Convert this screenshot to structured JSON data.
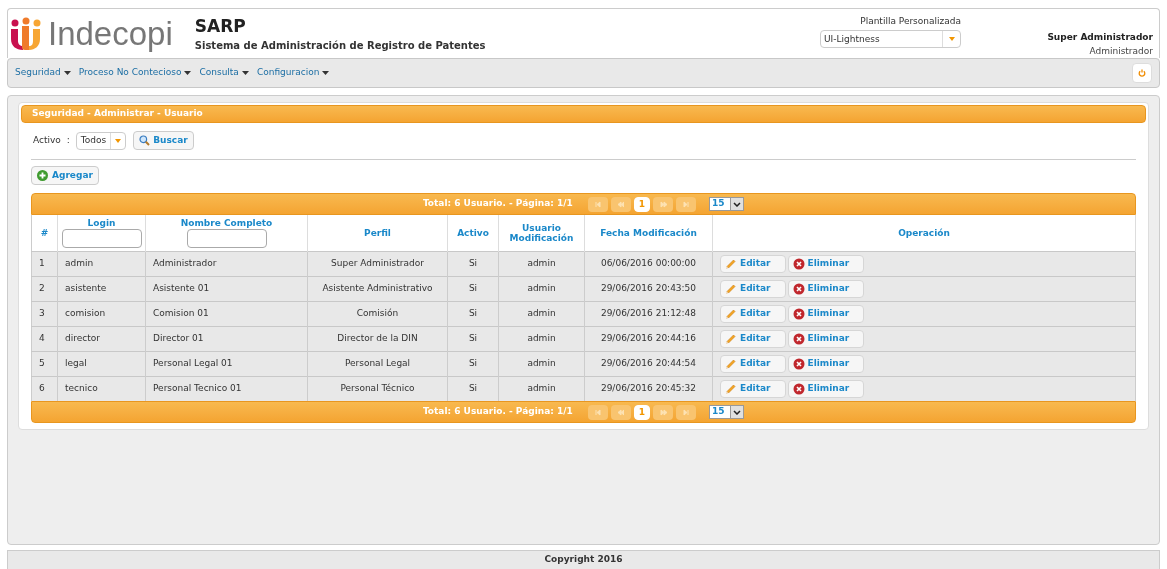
{
  "brand": {
    "logo_text": "Indecopi",
    "app_title": "SARP",
    "app_subtitle": "Sistema de Administración de Registro de Patentes"
  },
  "theme": {
    "label": "Plantilla Personalizada",
    "value": "UI-Lightness"
  },
  "user": {
    "name": "Super Administrador",
    "role": "Administrador"
  },
  "menu": [
    {
      "label": "Seguridad"
    },
    {
      "label": "Proceso No Contecioso"
    },
    {
      "label": "Consulta"
    },
    {
      "label": "Configuracion"
    }
  ],
  "panel": {
    "title": "Seguridad - Administrar - Usuario"
  },
  "filter": {
    "label": "Activo",
    "separator": ":",
    "value": "Todos",
    "search_button": "Buscar"
  },
  "add_button": "Agregar",
  "table": {
    "pagers": [
      {
        "summary": "Total: 6 Usuario. - Página: 1/1",
        "nav": [
          {
            "kind": "first",
            "disabled": true
          },
          {
            "kind": "prev",
            "disabled": true
          },
          {
            "kind": "page",
            "label": "1",
            "selected": true
          },
          {
            "kind": "next",
            "disabled": true
          },
          {
            "kind": "last",
            "disabled": true
          }
        ],
        "per_page": "15"
      },
      {
        "summary": "Total: 6 Usuario. - Página: 1/1",
        "nav": [
          {
            "kind": "first",
            "disabled": true
          },
          {
            "kind": "prev",
            "disabled": true
          },
          {
            "kind": "page",
            "label": "1",
            "selected": true
          },
          {
            "kind": "next",
            "disabled": true
          },
          {
            "kind": "last",
            "disabled": true
          }
        ],
        "per_page": "15"
      }
    ],
    "columns": [
      {
        "label": "#",
        "filter": false
      },
      {
        "label": "Login",
        "filter": true
      },
      {
        "label": "Nombre Completo",
        "filter": true
      },
      {
        "label": "Perfil",
        "filter": false
      },
      {
        "label": "Activo",
        "filter": false
      },
      {
        "label": "Usuario Modificación",
        "filter": false
      },
      {
        "label": "Fecha Modificación",
        "filter": false
      },
      {
        "label": "Operación",
        "filter": false
      }
    ],
    "rows": [
      {
        "cells": [
          "1",
          "admin",
          "Administrador",
          "Super Administrador",
          "Si",
          "admin",
          "06/06/2016 00:00:00"
        ],
        "actions": [
          "Editar",
          "Eliminar"
        ]
      },
      {
        "cells": [
          "2",
          "asistente",
          "Asistente 01",
          "Asistente Administrativo",
          "Si",
          "admin",
          "29/06/2016 20:43:50"
        ],
        "actions": [
          "Editar",
          "Eliminar"
        ]
      },
      {
        "cells": [
          "3",
          "comision",
          "Comision 01",
          "Comisión",
          "Si",
          "admin",
          "29/06/2016 21:12:48"
        ],
        "actions": [
          "Editar",
          "Eliminar"
        ]
      },
      {
        "cells": [
          "4",
          "director",
          "Director 01",
          "Director de la DIN",
          "Si",
          "admin",
          "29/06/2016 20:44:16"
        ],
        "actions": [
          "Editar",
          "Eliminar"
        ]
      },
      {
        "cells": [
          "5",
          "legal",
          "Personal Legal 01",
          "Personal Legal",
          "Si",
          "admin",
          "29/06/2016 20:44:54"
        ],
        "actions": [
          "Editar",
          "Eliminar"
        ]
      },
      {
        "cells": [
          "6",
          "tecnico",
          "Personal Tecnico 01",
          "Personal Técnico",
          "Si",
          "admin",
          "29/06/2016 20:45:32"
        ],
        "actions": [
          "Editar",
          "Eliminar"
        ]
      }
    ]
  },
  "footer": "Copyright 2016"
}
